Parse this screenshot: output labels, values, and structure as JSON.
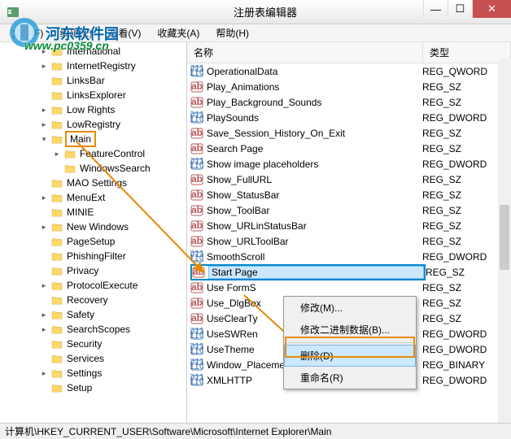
{
  "window": {
    "title": "注册表编辑器"
  },
  "watermark": {
    "site": "河东软件园",
    "url": "www.pc0359.cn"
  },
  "menu": {
    "file": "文件(F)",
    "edit": "编辑(E)",
    "view": "查看(V)",
    "favorites": "收藏夹(A)",
    "help": "帮助(H)"
  },
  "tree": {
    "items": [
      {
        "label": "International",
        "depth": 3,
        "expandable": true
      },
      {
        "label": "InternetRegistry",
        "depth": 3,
        "expandable": true
      },
      {
        "label": "LinksBar",
        "depth": 3,
        "expandable": false
      },
      {
        "label": "LinksExplorer",
        "depth": 3,
        "expandable": false
      },
      {
        "label": "Low Rights",
        "depth": 3,
        "expandable": true
      },
      {
        "label": "LowRegistry",
        "depth": 3,
        "expandable": true
      },
      {
        "label": "Main",
        "depth": 3,
        "expandable": true,
        "highlighted": true,
        "expanded": true
      },
      {
        "label": "FeatureControl",
        "depth": 4,
        "expandable": true
      },
      {
        "label": "WindowsSearch",
        "depth": 4,
        "expandable": false
      },
      {
        "label": "MAO Settings",
        "depth": 3,
        "expandable": false
      },
      {
        "label": "MenuExt",
        "depth": 3,
        "expandable": true
      },
      {
        "label": "MINIE",
        "depth": 3,
        "expandable": false
      },
      {
        "label": "New Windows",
        "depth": 3,
        "expandable": true
      },
      {
        "label": "PageSetup",
        "depth": 3,
        "expandable": false
      },
      {
        "label": "PhishingFilter",
        "depth": 3,
        "expandable": false
      },
      {
        "label": "Privacy",
        "depth": 3,
        "expandable": false
      },
      {
        "label": "ProtocolExecute",
        "depth": 3,
        "expandable": true
      },
      {
        "label": "Recovery",
        "depth": 3,
        "expandable": false
      },
      {
        "label": "Safety",
        "depth": 3,
        "expandable": true
      },
      {
        "label": "SearchScopes",
        "depth": 3,
        "expandable": true
      },
      {
        "label": "Security",
        "depth": 3,
        "expandable": false
      },
      {
        "label": "Services",
        "depth": 3,
        "expandable": false
      },
      {
        "label": "Settings",
        "depth": 3,
        "expandable": true
      },
      {
        "label": "Setup",
        "depth": 3,
        "expandable": false
      }
    ]
  },
  "list": {
    "header_name": "名称",
    "header_type": "类型",
    "rows": [
      {
        "name": "OperationalData",
        "type": "REG_QWORD",
        "icon": "num"
      },
      {
        "name": "Play_Animations",
        "type": "REG_SZ",
        "icon": "str"
      },
      {
        "name": "Play_Background_Sounds",
        "type": "REG_SZ",
        "icon": "str"
      },
      {
        "name": "PlaySounds",
        "type": "REG_DWORD",
        "icon": "num"
      },
      {
        "name": "Save_Session_History_On_Exit",
        "type": "REG_SZ",
        "icon": "str"
      },
      {
        "name": "Search Page",
        "type": "REG_SZ",
        "icon": "str"
      },
      {
        "name": "Show image placeholders",
        "type": "REG_DWORD",
        "icon": "num"
      },
      {
        "name": "Show_FullURL",
        "type": "REG_SZ",
        "icon": "str"
      },
      {
        "name": "Show_StatusBar",
        "type": "REG_SZ",
        "icon": "str"
      },
      {
        "name": "Show_ToolBar",
        "type": "REG_SZ",
        "icon": "str"
      },
      {
        "name": "Show_URLinStatusBar",
        "type": "REG_SZ",
        "icon": "str"
      },
      {
        "name": "Show_URLToolBar",
        "type": "REG_SZ",
        "icon": "str"
      },
      {
        "name": "SmoothScroll",
        "type": "REG_DWORD",
        "icon": "num"
      },
      {
        "name": "Start Page",
        "type": "REG_SZ",
        "icon": "str",
        "selected": true
      },
      {
        "name": "Use FormS",
        "type": "REG_SZ",
        "icon": "str"
      },
      {
        "name": "Use_DlgBox",
        "type": "REG_SZ",
        "icon": "str"
      },
      {
        "name": "UseClearTy",
        "type": "REG_SZ",
        "icon": "str"
      },
      {
        "name": "UseSWRen",
        "type": "REG_DWORD",
        "icon": "num"
      },
      {
        "name": "UseTheme",
        "type": "REG_DWORD",
        "icon": "num"
      },
      {
        "name": "Window_Placement",
        "type": "REG_BINARY",
        "icon": "num"
      },
      {
        "name": "XMLHTTP",
        "type": "REG_DWORD",
        "icon": "num"
      }
    ]
  },
  "context_menu": {
    "modify": "修改(M)...",
    "modify_binary": "修改二进制数据(B)...",
    "delete": "删除(D)",
    "rename": "重命名(R)"
  },
  "statusbar": {
    "path": "计算机\\HKEY_CURRENT_USER\\Software\\Microsoft\\Internet Explorer\\Main"
  }
}
